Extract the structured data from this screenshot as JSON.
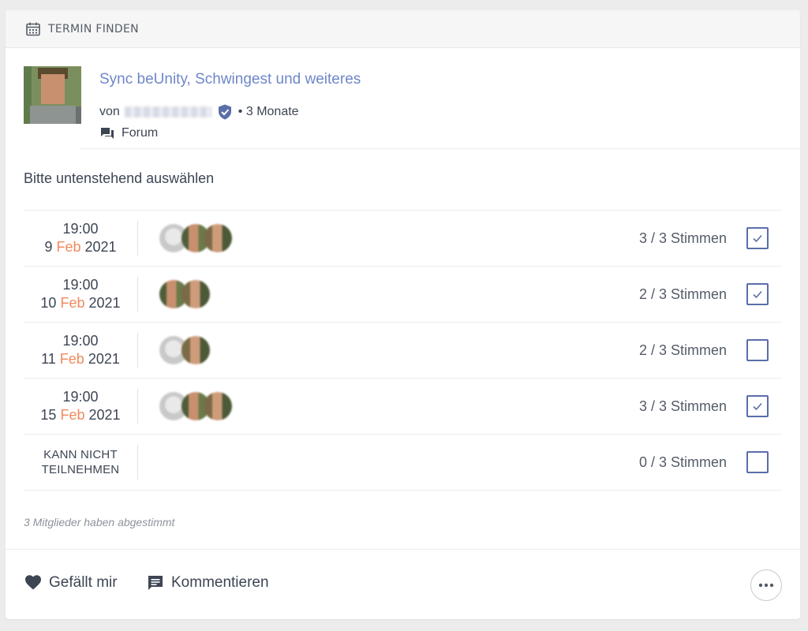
{
  "header": {
    "label": "TERMIN FINDEN",
    "icon": "calendar-icon"
  },
  "post": {
    "title": "Sync beUnity, Schwingest und weiteres",
    "by_prefix": "von",
    "age": "• 3 Monate",
    "space": "Forum"
  },
  "instruction": "Bitte untenstehend auswählen",
  "options": [
    {
      "time": "19:00",
      "day": "9",
      "month": "Feb",
      "year": "2021",
      "votes": "3 / 3 Stimmen",
      "checked": true,
      "voters": [
        "grey",
        "a",
        "b"
      ]
    },
    {
      "time": "19:00",
      "day": "10",
      "month": "Feb",
      "year": "2021",
      "votes": "2 / 3 Stimmen",
      "checked": true,
      "voters": [
        "a",
        "b"
      ]
    },
    {
      "time": "19:00",
      "day": "11",
      "month": "Feb",
      "year": "2021",
      "votes": "2 / 3 Stimmen",
      "checked": false,
      "voters": [
        "grey",
        "b"
      ]
    },
    {
      "time": "19:00",
      "day": "15",
      "month": "Feb",
      "year": "2021",
      "votes": "3 / 3 Stimmen",
      "checked": true,
      "voters": [
        "grey",
        "a",
        "b"
      ]
    }
  ],
  "cant_attend": {
    "line1": "KANN NICHT",
    "line2": "TEILNEHMEN",
    "votes": "0 / 3 Stimmen",
    "checked": false
  },
  "summary": "3 Mitglieder haben abgestimmt",
  "footer": {
    "like": "Gefällt mir",
    "comment": "Kommentieren"
  },
  "colors": {
    "accent": "#6f87c9",
    "month": "#f08a5d",
    "checkbox": "#5b6ea8"
  }
}
